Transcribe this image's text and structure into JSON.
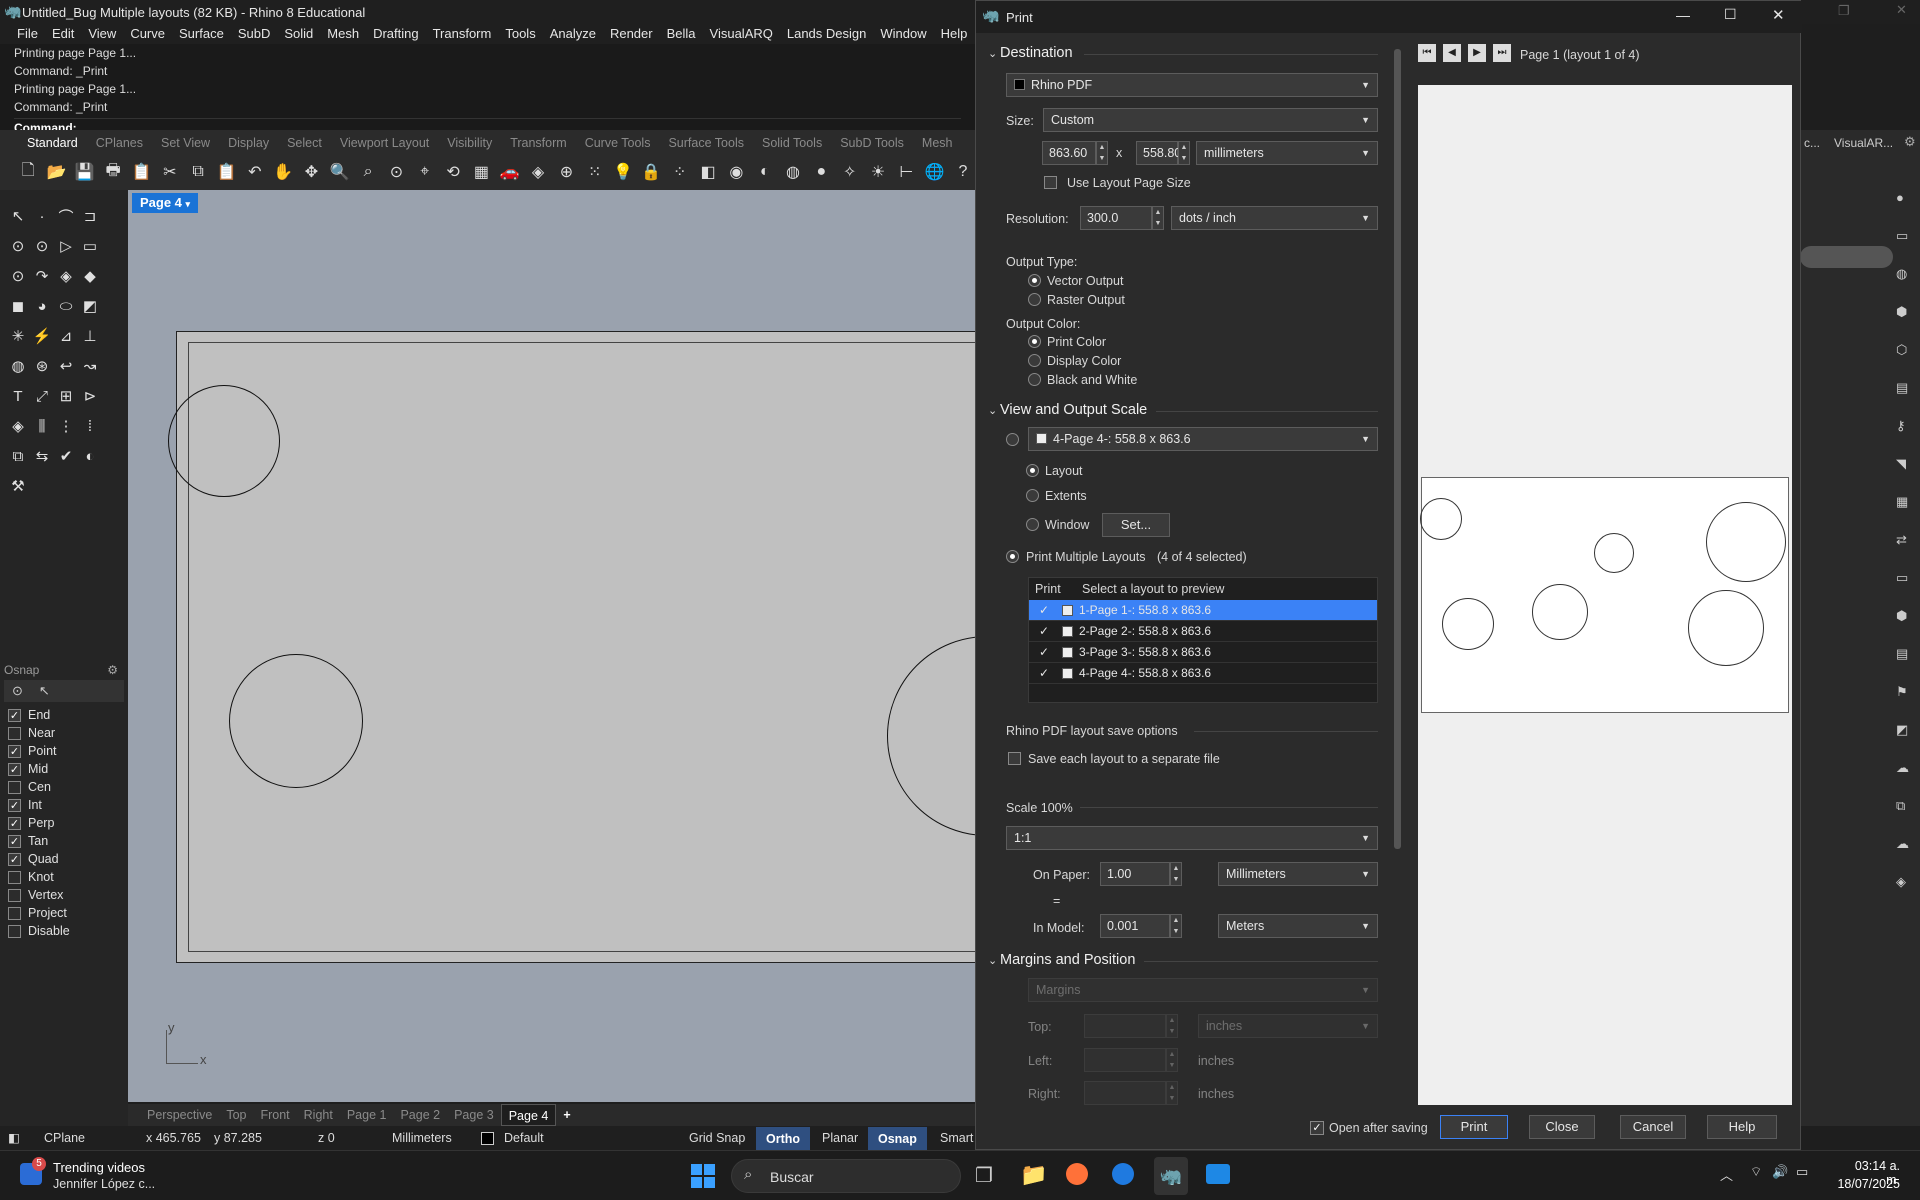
{
  "app": {
    "title": "Untitled_Bug Multiple layouts (82 KB) - Rhino 8 Educational",
    "menu": [
      "File",
      "Edit",
      "View",
      "Curve",
      "Surface",
      "SubD",
      "Solid",
      "Mesh",
      "Drafting",
      "Transform",
      "Tools",
      "Analyze",
      "Render",
      "Bella",
      "VisualARQ",
      "Lands Design",
      "Window",
      "Help"
    ],
    "command_history": [
      "Printing page Page 1...",
      "Command: _Print",
      "Printing page Page 1...",
      "Command: _Print"
    ],
    "command_prompt": "Command:",
    "toolbar_tabs": [
      "Standard",
      "CPlanes",
      "Set View",
      "Display",
      "Select",
      "Viewport Layout",
      "Visibility",
      "Transform",
      "Curve Tools",
      "Surface Tools",
      "Solid Tools",
      "SubD Tools",
      "Mesh"
    ],
    "right_tab_partial": "VisualAR...",
    "right_tab_partial2": "c..."
  },
  "viewport": {
    "active_tab": "Page 4",
    "axis_y": "y",
    "axis_x": "x",
    "tabs": [
      "Perspective",
      "Top",
      "Front",
      "Right",
      "Page 1",
      "Page 2",
      "Page 3",
      "Page 4"
    ],
    "add_tab": "+"
  },
  "osnap": {
    "title": "Osnap",
    "items": [
      {
        "label": "End",
        "checked": true
      },
      {
        "label": "Near",
        "checked": false
      },
      {
        "label": "Point",
        "checked": true
      },
      {
        "label": "Mid",
        "checked": true
      },
      {
        "label": "Cen",
        "checked": false
      },
      {
        "label": "Int",
        "checked": true
      },
      {
        "label": "Perp",
        "checked": true
      },
      {
        "label": "Tan",
        "checked": true
      },
      {
        "label": "Quad",
        "checked": true
      },
      {
        "label": "Knot",
        "checked": false
      },
      {
        "label": "Vertex",
        "checked": false
      },
      {
        "label": "Project",
        "checked": false
      },
      {
        "label": "Disable",
        "checked": false
      }
    ]
  },
  "status": {
    "cplane": "CPlane",
    "x": "x 465.765",
    "y": "y 87.285",
    "z": "z 0",
    "units": "Millimeters",
    "layer": "Default",
    "grid_snap": "Grid Snap",
    "ortho": "Ortho",
    "planar": "Planar",
    "osnap": "Osnap",
    "smart": "Smart"
  },
  "print": {
    "title": "Print",
    "destination": {
      "header": "Destination",
      "printer": "Rhino PDF",
      "size_label": "Size:",
      "size": "Custom",
      "width": "863.60",
      "x_sep": "x",
      "height": "558.80",
      "units": "millimeters",
      "use_layout_size": "Use Layout Page Size",
      "resolution_label": "Resolution:",
      "resolution": "300.0",
      "resolution_units": "dots / inch",
      "output_type_label": "Output Type:",
      "vector": "Vector Output",
      "raster": "Raster Output",
      "output_color_label": "Output Color:",
      "print_color": "Print Color",
      "display_color": "Display Color",
      "bw": "Black and White"
    },
    "view": {
      "header": "View and Output Scale",
      "view_combo": "4-Page 4-: 558.8 x 863.6",
      "layout": "Layout",
      "extents": "Extents",
      "window": "Window",
      "set_button": "Set...",
      "multiple": "Print Multiple Layouts",
      "selected_count": "(4 of 4 selected)",
      "col_print": "Print",
      "col_select": "Select a layout to preview",
      "layouts": [
        "1-Page 1-: 558.8 x 863.6",
        "2-Page 2-: 558.8 x 863.6",
        "3-Page 3-: 558.8 x 863.6",
        "4-Page 4-: 558.8 x 863.6"
      ],
      "pdf_options": "Rhino PDF layout save options",
      "save_each": "Save each layout to a separate file",
      "scale_label": "Scale 100%",
      "scale": "1:1",
      "on_paper_label": "On Paper:",
      "on_paper": "1.00",
      "on_paper_units": "Millimeters",
      "equals": "=",
      "in_model_label": "In Model:",
      "in_model": "0.001",
      "in_model_units": "Meters"
    },
    "margins": {
      "header": "Margins and Position",
      "mode": "Margins",
      "top_label": "Top:",
      "left_label": "Left:",
      "right_label": "Right:",
      "units": "inches"
    },
    "preview": {
      "page": "Page 1 (layout 1 of 4)"
    },
    "footer": {
      "open_after": "Open after saving",
      "print": "Print",
      "close": "Close",
      "cancel": "Cancel",
      "help": "Help"
    }
  },
  "taskbar": {
    "widget_title": "Trending videos",
    "widget_sub": "Jennifer López c...",
    "badge": "5",
    "search": "Buscar",
    "time": "03:14 a. m.",
    "date": "18/07/2025"
  }
}
